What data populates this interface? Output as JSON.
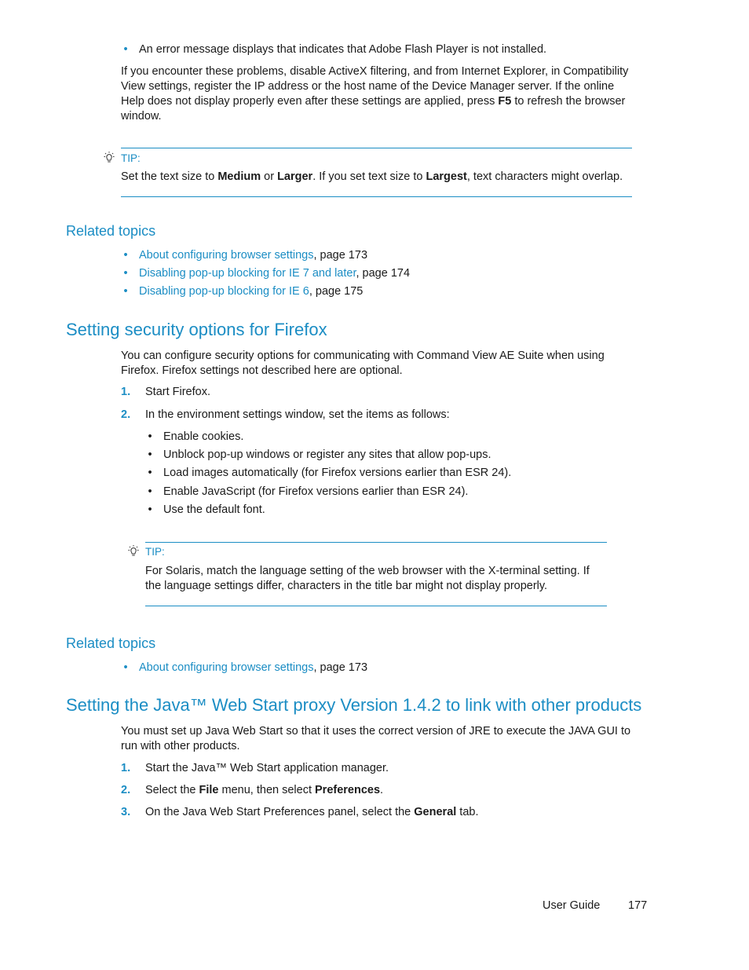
{
  "intro": {
    "bullet": "An error message displays that indicates that Adobe Flash Player is not installed.",
    "paragraph_lines": [
      "If you encounter these problems, disable ActiveX filtering, and from Internet Explorer, in Compatibility",
      "View settings, register the IP address or the host name of the Device Manager server. If the online"
    ],
    "paragraph_line3_pre": "Help does not display properly even after these settings are applied, press ",
    "paragraph_line3_bold": "F5",
    "paragraph_line3_post": " to refresh the browser",
    "paragraph_line4": "window."
  },
  "tip1": {
    "label": "TIP:",
    "parts": {
      "p1": "Set the text size to ",
      "b1": "Medium",
      "p2": " or ",
      "b2": "Larger",
      "p3": ". If you set text size to ",
      "b3": "Largest",
      "p4": ", text characters might overlap."
    }
  },
  "related1": {
    "heading": "Related topics",
    "items": [
      {
        "link": "About configuring browser settings",
        "page": ", page 173"
      },
      {
        "link": "Disabling pop-up blocking for IE 7 and later",
        "page": ", page 174"
      },
      {
        "link": "Disabling pop-up blocking for IE 6",
        "page": ", page 175"
      }
    ]
  },
  "firefox": {
    "heading": "Setting security options for Firefox",
    "intro_lines": [
      "You can configure security options for communicating with Command View AE Suite when using",
      "Firefox. Firefox settings not described here are optional."
    ],
    "steps": [
      {
        "num": "1.",
        "text": "Start Firefox."
      },
      {
        "num": "2.",
        "text": "In the environment settings window, set the items as follows:"
      }
    ],
    "sub_items": [
      "Enable cookies.",
      "Unblock pop-up windows or register any sites that allow pop-ups.",
      "Load images automatically (for Firefox versions earlier than ESR 24).",
      "Enable JavaScript (for Firefox versions earlier than ESR 24).",
      "Use the default font."
    ]
  },
  "tip2": {
    "label": "TIP:",
    "lines": [
      "For Solaris, match the language setting of the web browser with the X-terminal setting. If",
      "the language settings differ, characters in the title bar might not display properly."
    ]
  },
  "related2": {
    "heading": "Related topics",
    "items": [
      {
        "link": "About configuring browser settings",
        "page": ", page 173"
      }
    ]
  },
  "java": {
    "heading": "Setting the Java™ Web Start proxy Version 1.4.2 to link with other products",
    "intro_lines": [
      "You must set up Java Web Start so that it uses the correct version of JRE to execute the JAVA GUI to",
      "run with other products."
    ],
    "steps": [
      {
        "num": "1.",
        "pre": "Start the Java™ Web Start application manager."
      },
      {
        "num": "2.",
        "pre": "Select the ",
        "b1": "File",
        "mid": " menu, then select ",
        "b2": "Preferences",
        "post": "."
      },
      {
        "num": "3.",
        "pre": "On the Java Web Start Preferences panel, select the ",
        "b1": "General",
        "post": " tab."
      }
    ]
  },
  "footer": {
    "guide": "User Guide",
    "page": "177"
  },
  "icons": {
    "bullet": "bullet-dot",
    "tip": "lightbulb-icon"
  }
}
